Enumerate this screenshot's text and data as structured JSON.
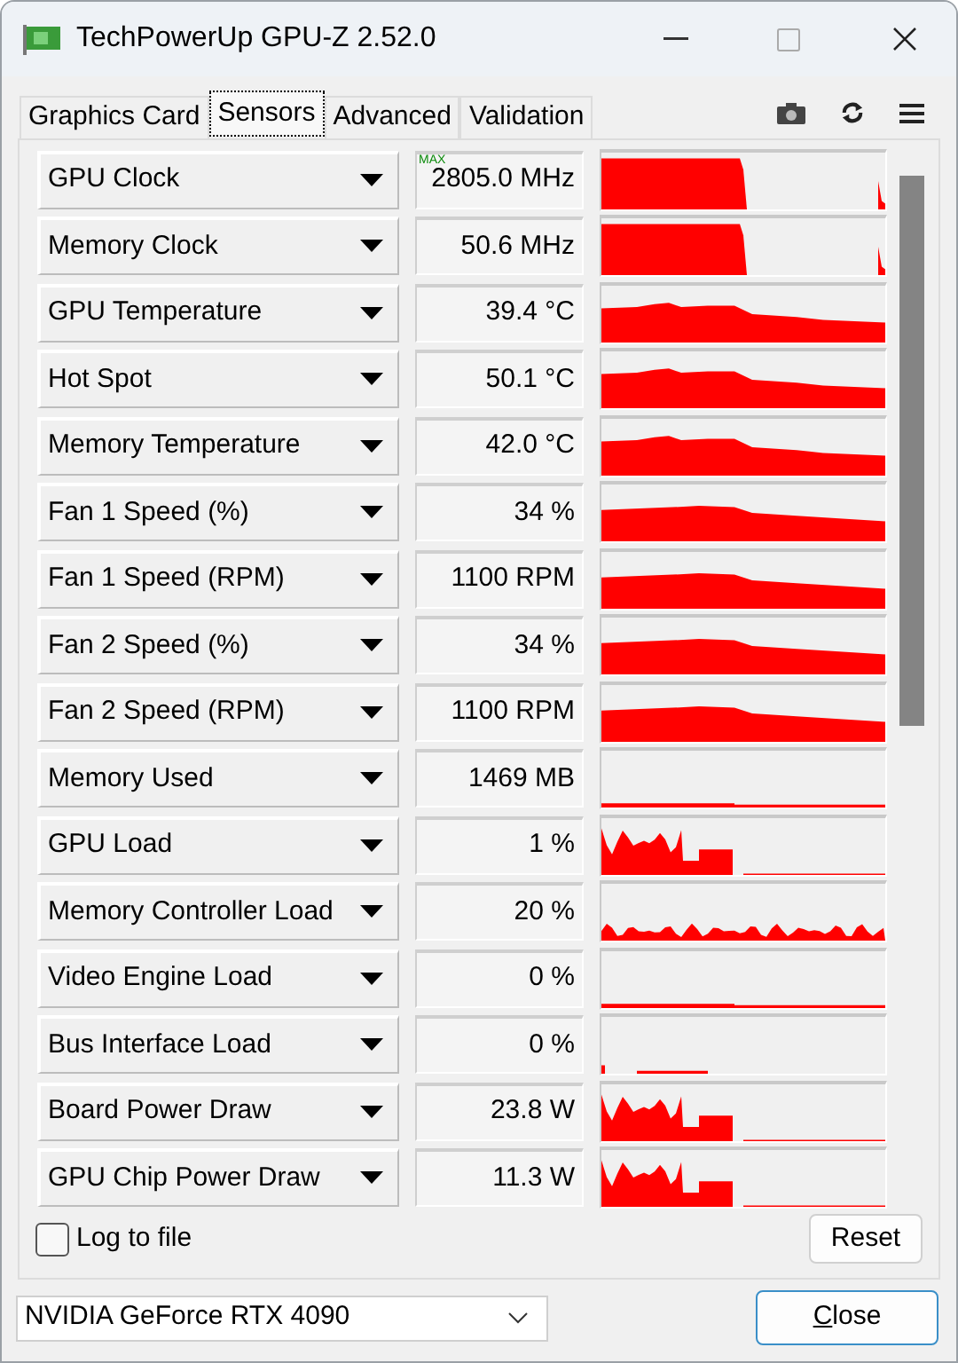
{
  "window": {
    "title": "TechPowerUp GPU-Z 2.52.0"
  },
  "tabs": [
    {
      "label": "Graphics Card",
      "selected": false
    },
    {
      "label": "Sensors",
      "selected": true
    },
    {
      "label": "Advanced",
      "selected": false
    },
    {
      "label": "Validation",
      "selected": false
    }
  ],
  "sensors": [
    {
      "name": "GPU Clock",
      "value": "2805.0 MHz",
      "badge": "MAX",
      "kind": "clock"
    },
    {
      "name": "Memory Clock",
      "value": "50.6 MHz",
      "kind": "clock"
    },
    {
      "name": "GPU Temperature",
      "value": "39.4 °C",
      "kind": "decay"
    },
    {
      "name": "Hot Spot",
      "value": "50.1 °C",
      "kind": "decay"
    },
    {
      "name": "Memory Temperature",
      "value": "42.0 °C",
      "kind": "decay"
    },
    {
      "name": "Fan 1 Speed (%)",
      "value": "34 %",
      "kind": "fan"
    },
    {
      "name": "Fan 1 Speed (RPM)",
      "value": "1100 RPM",
      "kind": "fan"
    },
    {
      "name": "Fan 2 Speed (%)",
      "value": "34 %",
      "kind": "fan"
    },
    {
      "name": "Fan 2 Speed (RPM)",
      "value": "1100 RPM",
      "kind": "fan"
    },
    {
      "name": "Memory Used",
      "value": "1469 MB",
      "kind": "line"
    },
    {
      "name": "GPU Load",
      "value": "1 %",
      "kind": "load"
    },
    {
      "name": "Memory Controller Load",
      "value": "20 %",
      "kind": "noise"
    },
    {
      "name": "Video Engine Load",
      "value": "0 %",
      "kind": "line"
    },
    {
      "name": "Bus Interface Load",
      "value": "0 %",
      "kind": "dots"
    },
    {
      "name": "Board Power Draw",
      "value": "23.8 W",
      "kind": "load"
    },
    {
      "name": "GPU Chip Power Draw",
      "value": "11.3 W",
      "kind": "load"
    }
  ],
  "log_to_file": {
    "label": "Log to file",
    "checked": false
  },
  "reset_button": "Reset",
  "device_select": {
    "value": "NVIDIA GeForce RTX 4090"
  },
  "close_button": "Close"
}
